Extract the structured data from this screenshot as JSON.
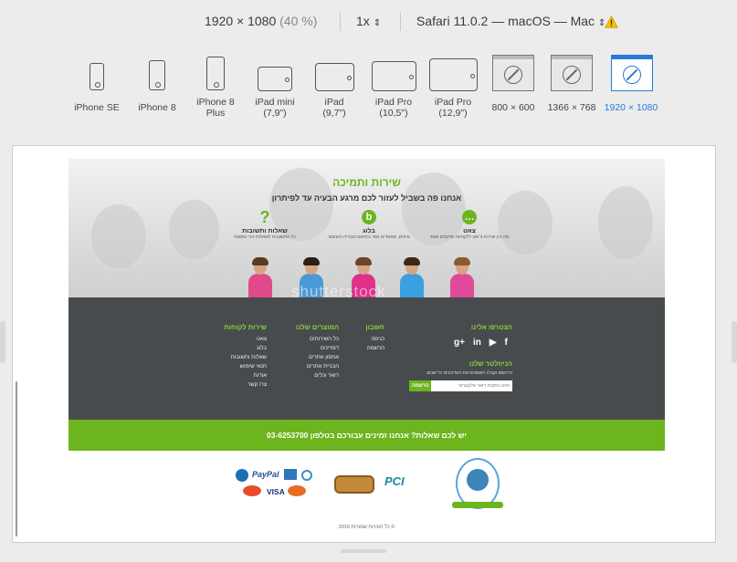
{
  "toolbar": {
    "resolution": "1920 × 1080",
    "zoom": "(40 %)",
    "scale": "1x",
    "browser": "Safari 11.0.2 — macOS — Mac"
  },
  "devices": [
    {
      "name": "iPhone SE",
      "sub": ""
    },
    {
      "name": "iPhone 8",
      "sub": ""
    },
    {
      "name": "iPhone 8",
      "sub": "Plus"
    },
    {
      "name": "iPad mini",
      "sub": "(7,9\")"
    },
    {
      "name": "iPad",
      "sub": "(9,7\")"
    },
    {
      "name": "iPad Pro",
      "sub": "(10,5\")"
    },
    {
      "name": "iPad Pro",
      "sub": "(12,9\")"
    },
    {
      "name": "800 × 600",
      "sub": ""
    },
    {
      "name": "1366 × 768",
      "sub": ""
    },
    {
      "name": "1920 × 1080",
      "sub": ""
    }
  ],
  "site": {
    "hero": {
      "title": "שירות ותמיכה",
      "subtitle": "אנחנו פה בשביל לעזור לכם מרגע הבעיה עד לפיתרון",
      "features": [
        {
          "title": "צאט",
          "desc": "מה בין שירות צ׳אט ללקוחות מתקדם אשר"
        },
        {
          "title": "בלוג",
          "desc": "טיפים, מאמרים ועוד בתחום הבנייה והעיצוב"
        },
        {
          "title": "שאלות ותשובות",
          "desc": "כל התשובות לשאלות הכי נפוצות"
        }
      ],
      "watermark": "shutterstock"
    },
    "footer": {
      "join_title": "הצטרפו אלינו",
      "social": [
        "f",
        "▶",
        "in",
        "g+"
      ],
      "newsletter_title": "הניוזלטר שלנו",
      "newsletter_desc": "הירשמו וקבלו ראשונים את העדכונים כל שבוע",
      "email_placeholder": "הזינו כתובת דואר אלקטרוני",
      "register_button": "הרשמה",
      "account": {
        "title": "חשבון",
        "links": [
          "כניסה",
          "הרשמה"
        ]
      },
      "products": {
        "title": "המוצרים שלנו",
        "links": [
          "כל השירותים",
          "דומיינים",
          "אחסון אתרים",
          "הבניית אתרים",
          "דואר וכלים"
        ]
      },
      "customer": {
        "title": "שירות לקוחות",
        "links": [
          "צאט",
          "בלוג",
          "שאלות ותשובות",
          "תנאי שימוש",
          "אודות",
          "צרו קשר"
        ]
      }
    },
    "banner": "יש לכם שאלות? אנחנו זמינים עבורכם בטלפון 03-6253700",
    "payments": [
      "PayPal",
      "VISA"
    ],
    "badges": [
      "PCI"
    ],
    "copyright": "2016 כל הזכויות שמורות ©"
  },
  "colors": {
    "accent": "#6cb51e",
    "selected": "#2a7ad8",
    "footer_bg": "#484b4d"
  }
}
